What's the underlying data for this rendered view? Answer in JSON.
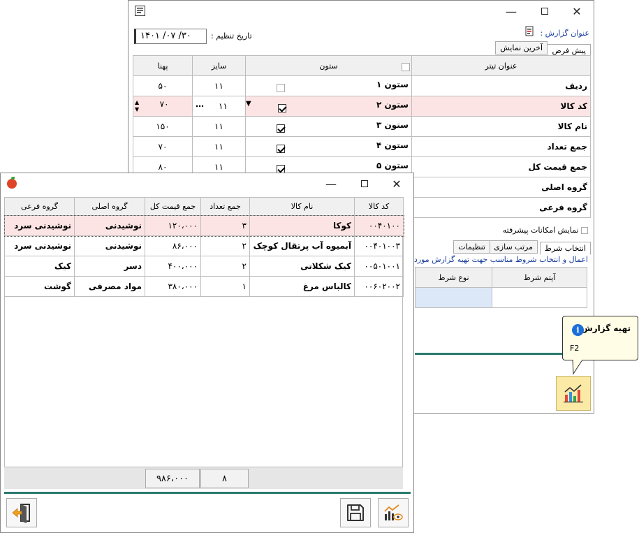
{
  "settings": {
    "date_label": "تاریخ تنظیم :",
    "date_value": "۱۴۰۱ /۰۷ /۳۰",
    "report_title_label": "عنوان گزارش :",
    "tabs": [
      "پیش فرض",
      "آخرین نمایش"
    ],
    "columns": [
      "عنوان تیتر",
      "ستون",
      "سایز",
      "پهنا"
    ],
    "rows": [
      {
        "title": "ردیف",
        "column": "ستون ۱",
        "size": "۱۱",
        "width": "۵۰",
        "checked": false
      },
      {
        "title": "کد کالا",
        "column": "ستون ۲",
        "size": "۱۱",
        "width": "۷۰",
        "checked": true
      },
      {
        "title": "نام کالا",
        "column": "ستون ۳",
        "size": "۱۱",
        "width": "۱۵۰",
        "checked": true
      },
      {
        "title": "جمع تعداد",
        "column": "ستون ۴",
        "size": "۱۱",
        "width": "۷۰",
        "checked": true
      },
      {
        "title": "جمع قیمت کل",
        "column": "ستون ۵",
        "size": "۱۱",
        "width": "۸۰",
        "checked": true
      },
      {
        "title": "گروه اصلی"
      },
      {
        "title": "گروه فرعی"
      }
    ],
    "advanced_label": "نمایش امکانات پیشرفته",
    "tabs2": [
      "انتخاب شرط",
      "مرتب سازی",
      "تنظیمات"
    ],
    "instruction": "اعمال و انتخاب شروط مناسب جهت تهیه گزارش  مورد",
    "condition_columns": [
      "آیتم شرط",
      "نوع شرط"
    ]
  },
  "tooltip": {
    "title": "تهیه گزارش",
    "shortcut": "F2"
  },
  "report": {
    "columns": [
      "کد کالا",
      "نام کالا",
      "جمع تعداد",
      "جمع قیمت کل",
      "گروه اصلی",
      "گروه فرعی"
    ],
    "rows": [
      [
        "۰۰۴۰۱۰۰",
        "کوکا",
        "۳",
        "۱۲۰،۰۰۰",
        "نوشیدنی",
        "نوشیدنی سرد"
      ],
      [
        "۰۰۴۰۱۰۰۳",
        "آبمیوه آب پرتقال کوچک",
        "۲",
        "۸۶،۰۰۰",
        "نوشیدنی",
        "نوشیدنی سرد"
      ],
      [
        "۰۰۵۰۱۰۰۱",
        "کیک شکلاتی",
        "۲",
        "۴۰۰،۰۰۰",
        "دسر",
        "کیک"
      ],
      [
        "۰۰۶۰۲۰۰۲",
        "کالباس مرغ",
        "۱",
        "۳۸۰،۰۰۰",
        "مواد مصرفی",
        "گوشت"
      ]
    ],
    "total_qty": "۸",
    "total_price": "۹۸۶،۰۰۰"
  }
}
